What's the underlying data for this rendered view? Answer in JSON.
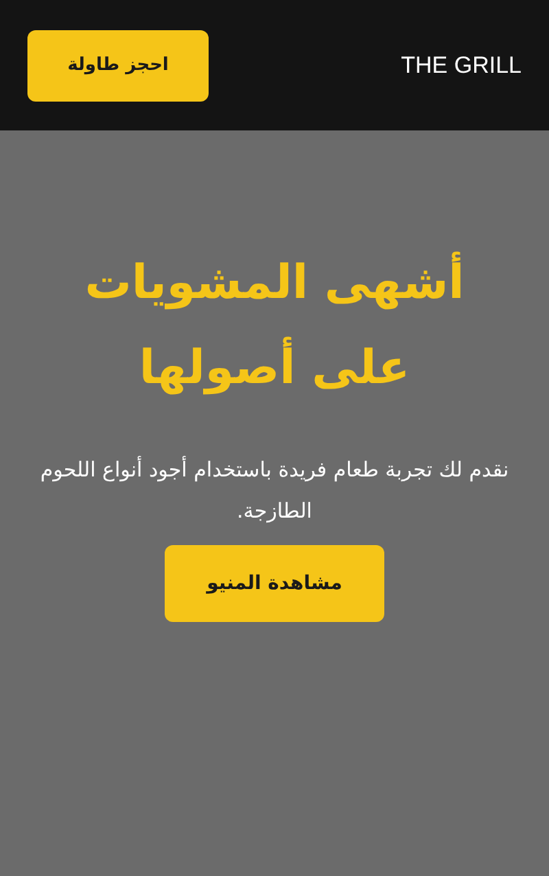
{
  "header": {
    "brand": "THE GRILL",
    "reserve_button": "احجز طاولة"
  },
  "hero": {
    "title": "أشهى المشويات على أصولها",
    "text": "نقدم لك تجربة طعام فريدة باستخدام أجود أنواع اللحوم الطازجة.",
    "menu_button": "مشاهدة المنيو"
  }
}
